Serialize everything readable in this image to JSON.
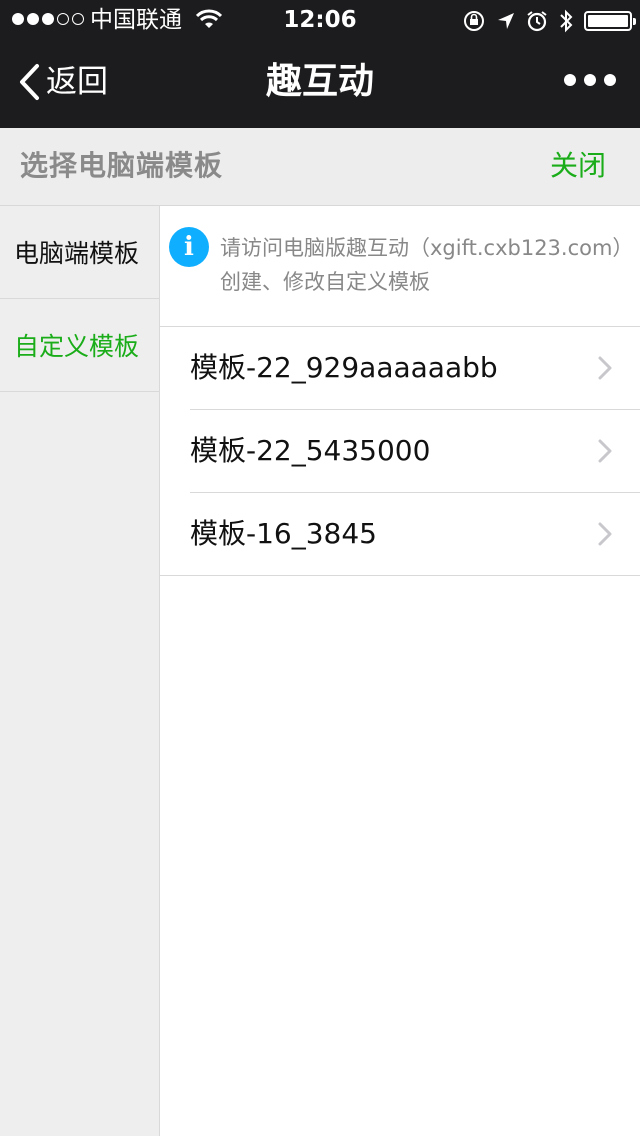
{
  "status_bar": {
    "carrier": "中国联通",
    "time": "12:06"
  },
  "nav": {
    "back_label": "返回",
    "title": "趣互动"
  },
  "subheader": {
    "title": "选择电脑端模板",
    "close_label": "关闭"
  },
  "sidebar": {
    "items": [
      {
        "label": "电脑端模板",
        "active": false
      },
      {
        "label": "自定义模板",
        "active": true
      }
    ]
  },
  "notice": {
    "line1": "请访问电脑版趣互动（xgift.cxb123.com）",
    "line2": "创建、修改自定义模板"
  },
  "templates": [
    {
      "label": "模板-22_929aaaaaabb"
    },
    {
      "label": "模板-22_5435000"
    },
    {
      "label": "模板-16_3845"
    }
  ],
  "colors": {
    "accent": "#1aad19",
    "info": "#10aeff",
    "topbar": "#1c1c1e",
    "sidebar_bg": "#eeeeee"
  }
}
